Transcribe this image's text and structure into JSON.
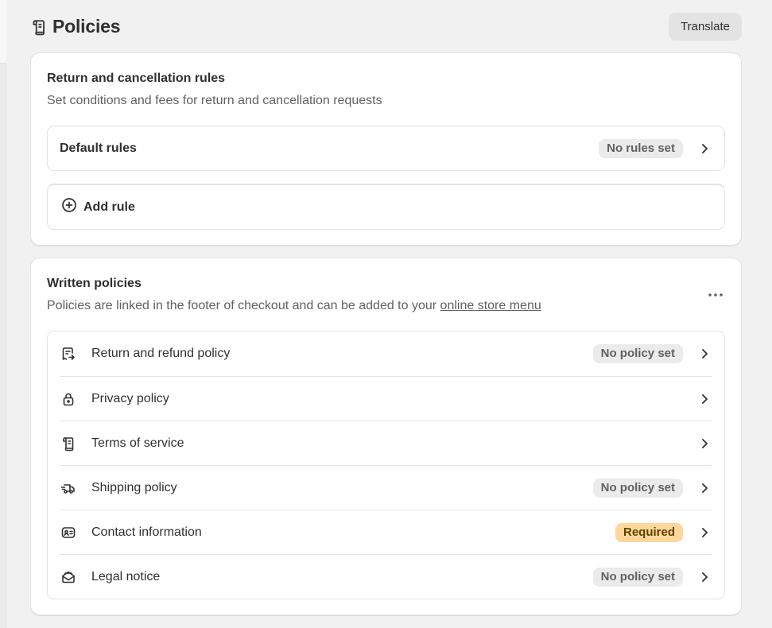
{
  "header": {
    "title": "Policies",
    "title_icon": "scroll-icon",
    "translate_label": "Translate"
  },
  "rules_card": {
    "title": "Return and cancellation rules",
    "subtitle": "Set conditions and fees for return and cancellation requests",
    "default_rules": {
      "label": "Default rules",
      "badge": "No rules set"
    },
    "add_rule_label": "Add rule"
  },
  "written_card": {
    "title": "Written policies",
    "subtitle_prefix": "Policies are linked in the footer of checkout and can be added to your ",
    "subtitle_link": "online store menu",
    "more_icon": "ellipsis-icon",
    "policies": [
      {
        "label": "Return and refund policy",
        "badge": "No policy set",
        "icon": "return-receipt-icon"
      },
      {
        "label": "Privacy policy",
        "badge": "",
        "icon": "lock-icon"
      },
      {
        "label": "Terms of service",
        "badge": "",
        "icon": "scroll-icon"
      },
      {
        "label": "Shipping policy",
        "badge": "No policy set",
        "icon": "delivery-truck-icon"
      },
      {
        "label": "Contact information",
        "badge": "Required",
        "icon": "contact-card-icon"
      },
      {
        "label": "Legal notice",
        "badge": "No policy set",
        "icon": "mail-open-icon"
      }
    ]
  },
  "colors": {
    "page_bg": "#f1f1f1",
    "card_bg": "#ffffff",
    "badge_bg": "#ebebeb",
    "required_badge_bg": "#ffd79d",
    "text": "#303030",
    "muted_text": "#616161"
  }
}
